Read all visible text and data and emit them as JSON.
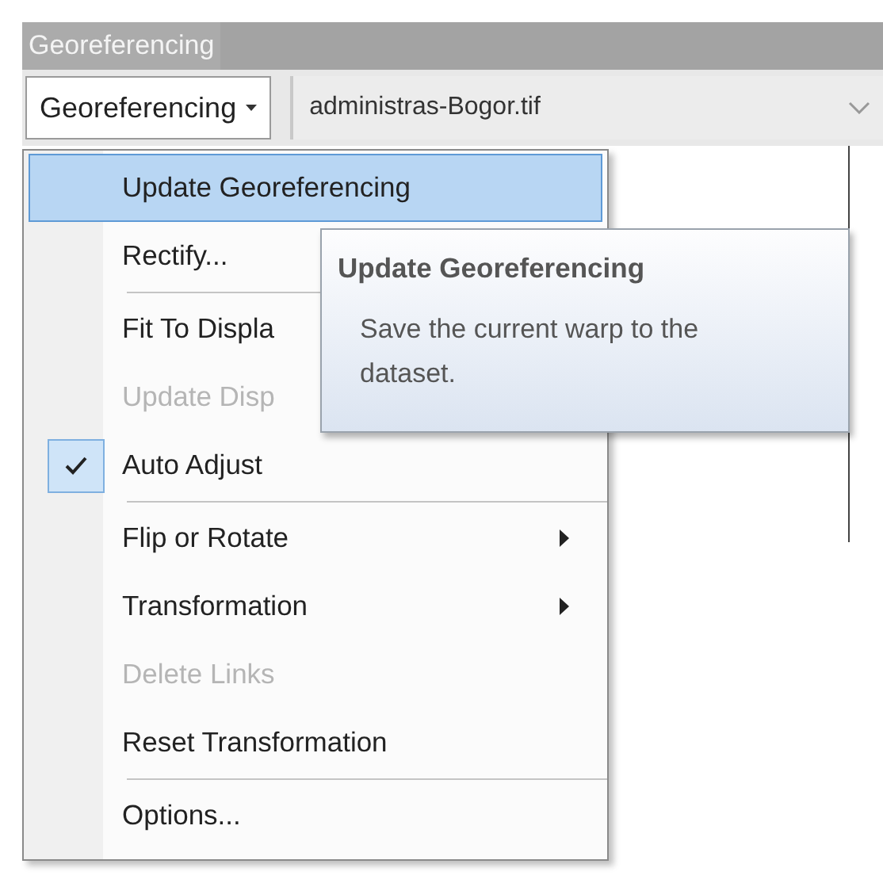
{
  "toolbar": {
    "title": "Georeferencing",
    "menu_button": {
      "label": "Georeferencing",
      "expanded": true
    },
    "layer_combo": {
      "value": "administras-Bogor.tif"
    }
  },
  "menu": {
    "items": [
      {
        "kind": "item",
        "label": "Update Georeferencing",
        "selected": true,
        "disabled": false,
        "checked": false,
        "submenu": false
      },
      {
        "kind": "item",
        "label": "Rectify...",
        "selected": false,
        "disabled": false,
        "checked": false
      },
      {
        "kind": "separator"
      },
      {
        "kind": "item",
        "label": "Fit To Displa",
        "selected": false,
        "disabled": false,
        "checked": false
      },
      {
        "kind": "item",
        "label": "Update Disp",
        "selected": false,
        "disabled": true,
        "checked": false
      },
      {
        "kind": "item",
        "label": "Auto Adjust",
        "selected": false,
        "disabled": false,
        "checked": true,
        "submenu": false
      },
      {
        "kind": "separator"
      },
      {
        "kind": "item",
        "label": "Flip or Rotate",
        "selected": false,
        "disabled": false,
        "checked": false,
        "submenu": true
      },
      {
        "kind": "item",
        "label": "Transformation",
        "selected": false,
        "disabled": false,
        "checked": false,
        "submenu": true
      },
      {
        "kind": "item",
        "label": "Delete Links",
        "selected": false,
        "disabled": true,
        "checked": false,
        "submenu": false
      },
      {
        "kind": "item",
        "label": "Reset Transformation",
        "selected": false,
        "disabled": false,
        "checked": false,
        "submenu": false
      },
      {
        "kind": "separator"
      },
      {
        "kind": "item",
        "label": "Options...",
        "selected": false,
        "disabled": false,
        "checked": false,
        "submenu": false
      }
    ]
  },
  "tooltip": {
    "title": "Update Georeferencing",
    "text": "Save the current warp to the dataset."
  }
}
